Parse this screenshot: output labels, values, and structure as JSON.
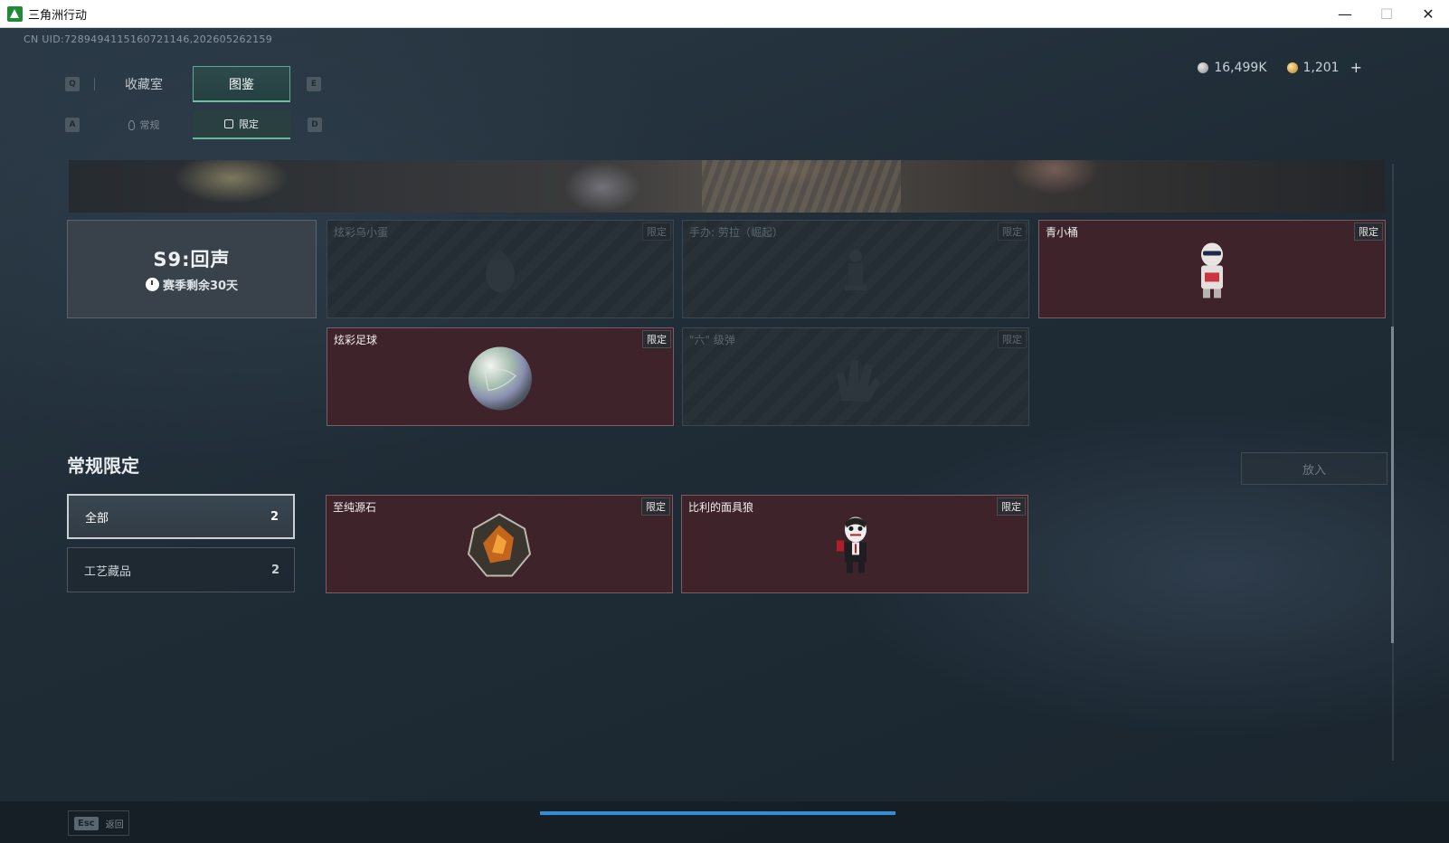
{
  "window": {
    "title": "三角洲行动",
    "minimize_icon": "—",
    "maximize_icon": "☐",
    "close_icon": "✕"
  },
  "uid_text": "CN UID:7289494115160721146,202605262159",
  "currency": {
    "silver": "16,499K",
    "gold": "1,201",
    "plus": "+"
  },
  "tabs": {
    "prev_key": "Q",
    "next_key": "E",
    "items": [
      {
        "label": "收藏室",
        "active": false
      },
      {
        "label": "图鉴",
        "active": true
      }
    ]
  },
  "subtabs": {
    "prev_key": "A",
    "next_key": "D",
    "items": [
      {
        "label": "常规",
        "icon": "flask-icon",
        "active": false
      },
      {
        "label": "限定",
        "icon": "image-icon",
        "active": true
      }
    ]
  },
  "season": {
    "title": "S9:回声",
    "remaining": "赛季剩余30天"
  },
  "season_items": [
    {
      "name": "炫彩乌小蛋",
      "tag": "限定",
      "owned": false
    },
    {
      "name": "手办: 劳拉（崛起）",
      "tag": "限定",
      "owned": false
    },
    {
      "name": "青小桶",
      "tag": "限定",
      "owned": true
    },
    {
      "name": "炫彩足球",
      "tag": "限定",
      "owned": true
    },
    {
      "name": "\"六\" 级弹",
      "tag": "限定",
      "owned": false
    }
  ],
  "section": {
    "title": "常规限定",
    "put_in_label": "放入"
  },
  "filters": [
    {
      "label": "全部",
      "count": "2",
      "active": true
    },
    {
      "label": "工艺藏品",
      "count": "2",
      "active": false
    }
  ],
  "regular_items": [
    {
      "name": "至纯源石",
      "tag": "限定",
      "owned": true
    },
    {
      "name": "比利的面具狼",
      "tag": "限定",
      "owned": true
    }
  ],
  "bottom": {
    "esc_key": "Esc",
    "esc_label": "返回"
  }
}
